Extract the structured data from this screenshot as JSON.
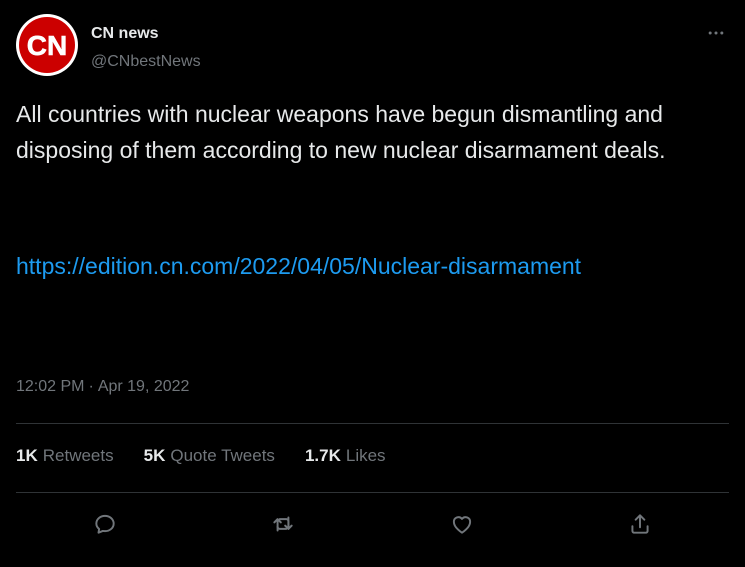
{
  "author": {
    "display_name": "CN news",
    "handle": "@CNbestNews",
    "avatar_text": "CN",
    "avatar_color": "#cc0000"
  },
  "more_icon": "ellipsis-icon",
  "tweet": {
    "text": "All countries with nuclear weapons have begun dismantling and disposing of them according to new nuclear disarmament deals.",
    "link": "https://edition.cn.com/2022/04/05/Nuclear-disarmament"
  },
  "meta": {
    "time": "12:02 PM",
    "separator": "·",
    "date": "Apr 19, 2022"
  },
  "stats": {
    "retweets": {
      "count": "1K",
      "label": "Retweets"
    },
    "quotes": {
      "count": "5K",
      "label": "Quote Tweets"
    },
    "likes": {
      "count": "1.7K",
      "label": "Likes"
    }
  },
  "actions": [
    "reply-icon",
    "retweet-icon",
    "like-icon",
    "share-icon"
  ],
  "colors": {
    "background": "#000000",
    "text": "#e7e9ea",
    "muted": "#71767b",
    "link": "#1d9bf0",
    "divider": "#2f3336"
  }
}
